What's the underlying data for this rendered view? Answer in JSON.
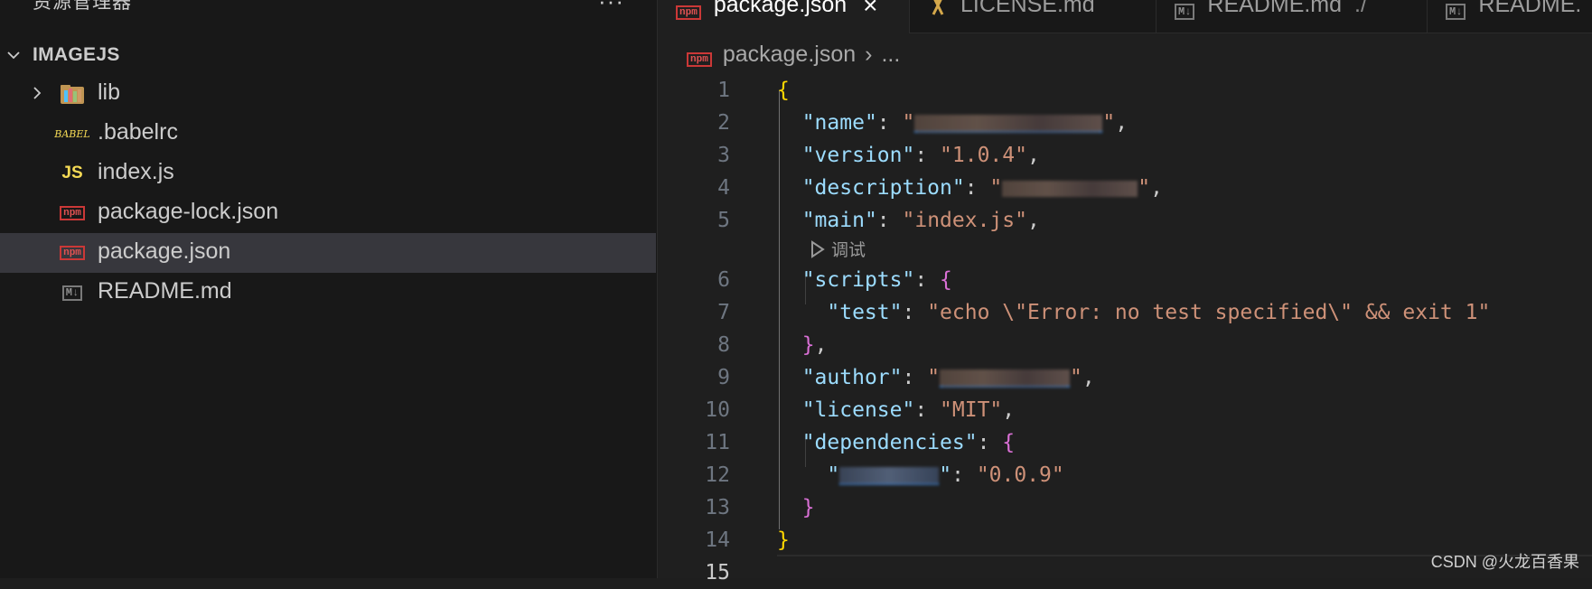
{
  "sidebar": {
    "title": "资源管理器",
    "more": "···",
    "section": "IMAGEJS",
    "items": [
      {
        "label": "lib",
        "icon": "folder-lib-icon",
        "type": "folder"
      },
      {
        "label": ".babelrc",
        "icon": "babel-icon",
        "icon_text": "BABEL"
      },
      {
        "label": "index.js",
        "icon": "javascript-icon",
        "icon_text": "JS"
      },
      {
        "label": "package-lock.json",
        "icon": "npm-icon",
        "icon_text": "npm"
      },
      {
        "label": "package.json",
        "icon": "npm-icon",
        "icon_text": "npm",
        "selected": true
      },
      {
        "label": "README.md",
        "icon": "markdown-icon",
        "icon_text": "M↓"
      }
    ]
  },
  "tabs": [
    {
      "label": "package.json",
      "icon": "npm-icon",
      "icon_text": "npm",
      "close": "×",
      "active": true
    },
    {
      "label": "LICENSE.md",
      "icon": "license-icon"
    },
    {
      "label": "README.md",
      "icon": "markdown-icon",
      "icon_text": "M↓",
      "description": "./"
    },
    {
      "label": "README.",
      "icon": "markdown-icon",
      "icon_text": "M↓"
    }
  ],
  "breadcrumb": {
    "file": "package.json",
    "icon_text": "npm",
    "sep": "›",
    "rest": "..."
  },
  "codelens": {
    "label": "调试"
  },
  "code": {
    "line_numbers": [
      "1",
      "2",
      "3",
      "4",
      "5",
      "6",
      "7",
      "8",
      "9",
      "10",
      "11",
      "12",
      "13",
      "14",
      "15"
    ],
    "open_brace": "{",
    "close_brace": "}",
    "keys": {
      "name": "\"name\"",
      "version": "\"version\"",
      "description": "\"description\"",
      "main": "\"main\"",
      "scripts": "\"scripts\"",
      "test": "\"test\"",
      "author": "\"author\"",
      "license": "\"license\"",
      "dependencies": "\"dependencies\""
    },
    "values": {
      "version": "\"1.0.4\"",
      "main": "\"index.js\"",
      "test": "\"echo \\\"Error: no test specified\\\" && exit 1\"",
      "license": "\"MIT\"",
      "dep_version": "\"0.0.9\""
    },
    "punct": {
      "colon": ": ",
      "comma": ",",
      "quote": "\""
    }
  },
  "watermark": "CSDN @火龙百香果",
  "colors": {
    "key": "#9cdcfe",
    "string": "#ce9178",
    "brace1": "#ffd700",
    "brace2": "#da70d6",
    "selected_row": "#37373d"
  }
}
